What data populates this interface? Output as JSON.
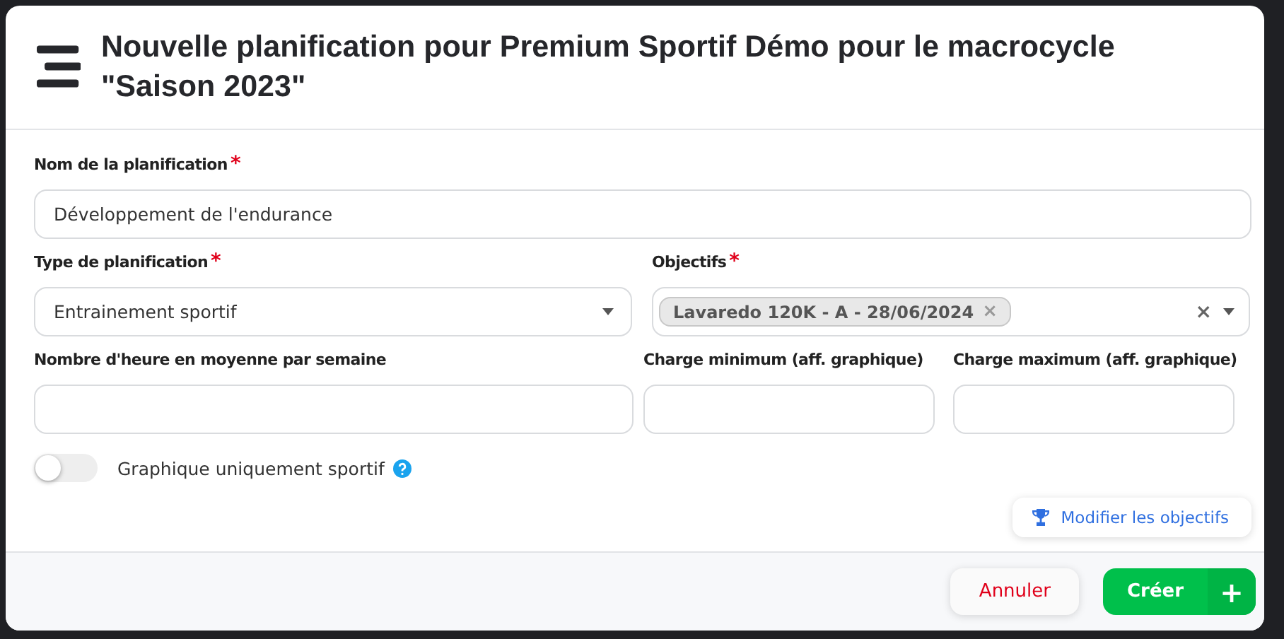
{
  "dialog": {
    "title": "Nouvelle planification pour Premium Sportif Démo pour le macrocycle \"Saison 2023\""
  },
  "fields": {
    "name": {
      "label": "Nom de la planification",
      "required_mark": "*",
      "value": "Développement de l'endurance"
    },
    "type": {
      "label": "Type de planification",
      "required_mark": "*",
      "value": "Entrainement sportif"
    },
    "objectives": {
      "label": "Objectifs",
      "required_mark": "*",
      "tags": [
        "Lavaredo 120K - A - 28/06/2024"
      ],
      "tag_remove": "×",
      "clear": "×"
    },
    "hours": {
      "label": "Nombre d'heure en moyenne par semaine"
    },
    "charge_min": {
      "label": "Charge minimum (aff. graphique)"
    },
    "charge_max": {
      "label": "Charge maximum (aff. graphique)"
    }
  },
  "toggle": {
    "label": "Graphique uniquement sportif",
    "on": false
  },
  "edit_objectives_button": "Modifier les objectifs",
  "buttons": {
    "cancel": "Annuler",
    "create": "Créer",
    "create_plus": "+"
  }
}
